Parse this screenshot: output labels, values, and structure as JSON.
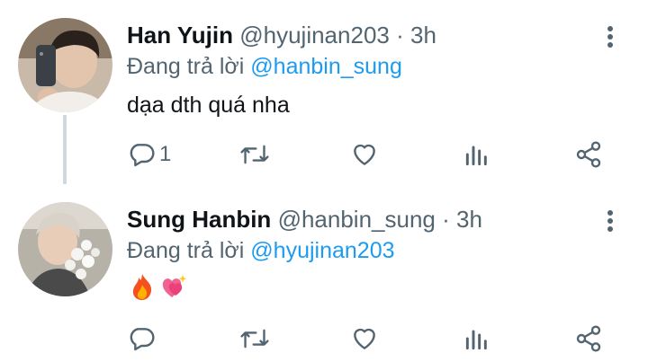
{
  "tweets": [
    {
      "name": "Han Yujin",
      "handle": "@hyujinan203",
      "separator": "·",
      "time": "3h",
      "replying_prefix": "Đang trả lời",
      "replying_to": "@hanbin_sung",
      "text": "dạa dth quá nha",
      "reply_count": "1",
      "icons": [
        "reply-icon",
        "retweet-icon",
        "like-icon",
        "views-icon",
        "share-icon",
        "more-icon"
      ]
    },
    {
      "name": "Sung Hanbin",
      "handle": "@hanbin_sung",
      "separator": "·",
      "time": "3h",
      "replying_prefix": "Đang trả lời",
      "replying_to": "@hyujinan203",
      "emojis": [
        "fire-emoji",
        "heart-with-sparkles-emoji"
      ],
      "reply_count": "",
      "icons": [
        "reply-icon",
        "retweet-icon",
        "like-icon",
        "views-icon",
        "share-icon",
        "more-icon"
      ]
    }
  ],
  "colors": {
    "link": "#1d9bf0",
    "secondary_text": "#536471",
    "icon": "#536471",
    "thread_line": "#cfd9de"
  }
}
